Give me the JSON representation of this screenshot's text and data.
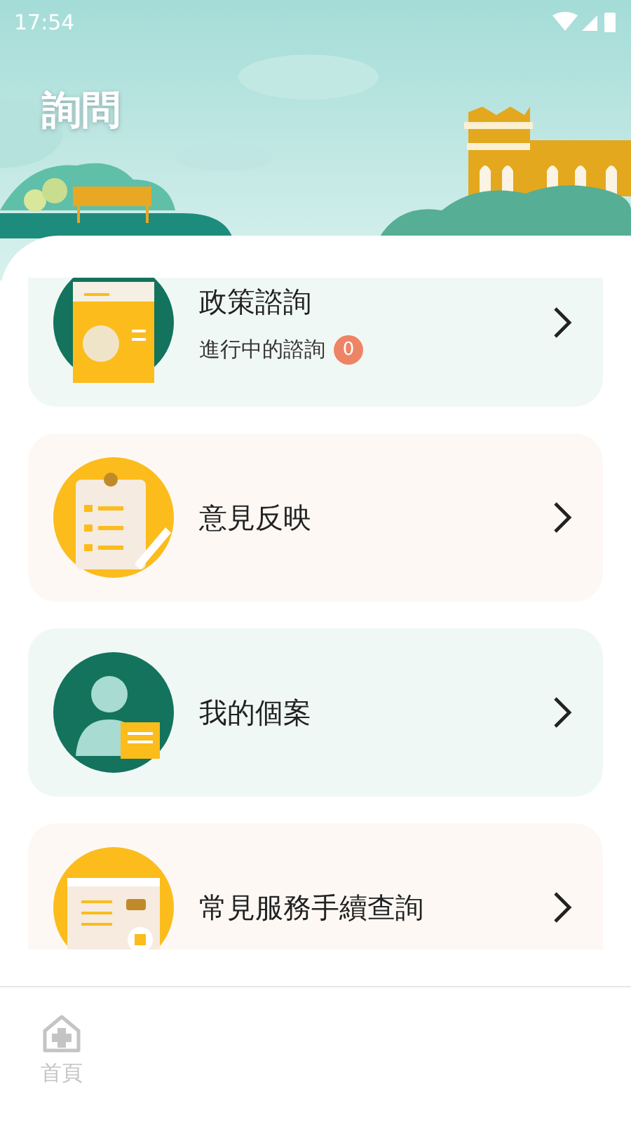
{
  "status_bar": {
    "time": "17:54"
  },
  "header": {
    "title": "詢問"
  },
  "items": [
    {
      "kind": "policy",
      "title": "政策諮詢",
      "subtitle": "進行中的諮詢",
      "badge": "0",
      "color": "#f0f8f5"
    },
    {
      "kind": "feedback",
      "title": "意見反映",
      "color": "#fdf8f4"
    },
    {
      "kind": "case",
      "title": "我的個案",
      "color": "#f0f8f5"
    },
    {
      "kind": "procedure",
      "title": "常見服務手續查詢",
      "color": "#fdf8f4"
    }
  ],
  "bottom_nav": [
    {
      "label": "首頁",
      "selected": false
    }
  ]
}
